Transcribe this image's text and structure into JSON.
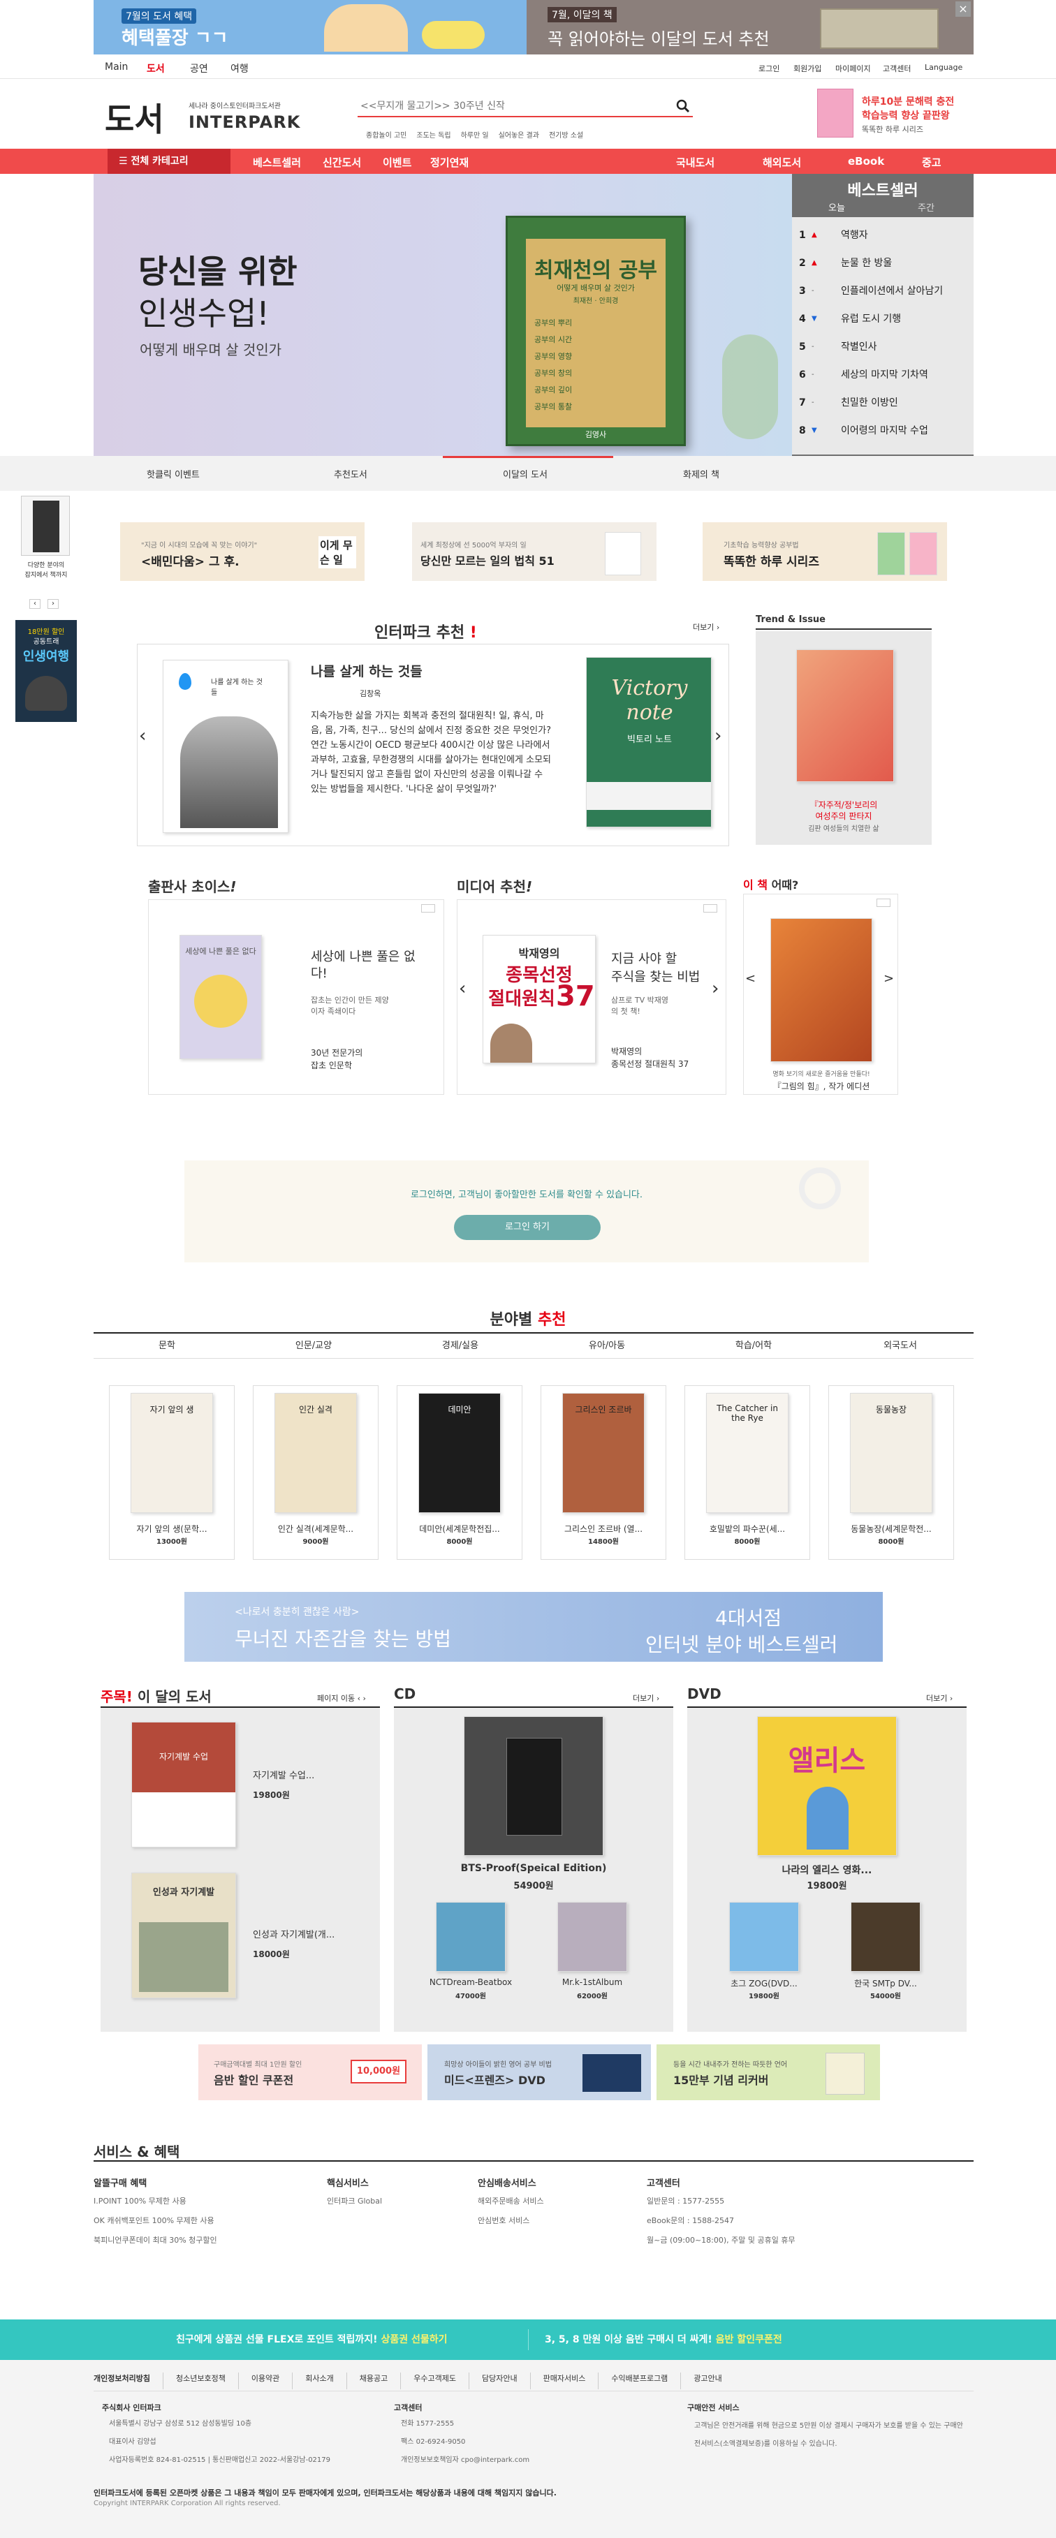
{
  "top_banner": {
    "left_small": "7월의 도서 혜택",
    "left_big": "혜택풀장 ㄱㄱ",
    "right_small": "7월, 이달의 책",
    "right_big": "꼭 읽어야하는 이달의 도서 추천",
    "close": "×"
  },
  "gnb": {
    "items": [
      "Main",
      "도서",
      "공연",
      "여행"
    ],
    "util": [
      "로그인",
      "회원가입",
      "마이페이지",
      "고객센터",
      "Language"
    ]
  },
  "logo": {
    "big": "도서",
    "sub": "세나라 중이스토인터파크도서관",
    "brand": "INTERPARK"
  },
  "search": {
    "placeholder": "<<무지개 물고기>> 30주년 신작",
    "tags": [
      "종합놀이 고민",
      "조도는 독립",
      "하루만 일",
      "실어놓은 결과",
      "전기방 소설"
    ]
  },
  "side_promo": {
    "line1": "하루10분 문해력 충전",
    "line2": "학습능력 향상 끝판왕",
    "line3": "똑똑한 하루 시리즈"
  },
  "nav": {
    "category": "전체 카테고리",
    "left": [
      "베스트셀러",
      "신간도서",
      "이벤트",
      "정기연재"
    ],
    "right": [
      "국내도서",
      "해외도서",
      "eBook",
      "중고"
    ]
  },
  "hero": {
    "line1": "당신을 위한",
    "line2": "인생수업!",
    "sub": "어떻게 배우며 살 것인가",
    "book_title": "최재천의 공부",
    "book_sub": "어떻게 배우며 살 것인가",
    "book_author": "최재천 · 안희경",
    "book_lines": [
      "공부의 뿌리",
      "공부의 시간",
      "공부의 영향",
      "공부의 창의",
      "공부의 깊이",
      "공부의 통찰"
    ],
    "book_publisher": "김영사"
  },
  "bestseller": {
    "title": "베스트셀러",
    "tabs": [
      "오늘",
      "주간"
    ],
    "items": [
      {
        "rank": "1",
        "trend": "up",
        "title": "역행자"
      },
      {
        "rank": "2",
        "trend": "up",
        "title": "눈물 한 방울"
      },
      {
        "rank": "3",
        "trend": "same",
        "title": "인플레이션에서 살아남기"
      },
      {
        "rank": "4",
        "trend": "down",
        "title": "유럽 도시 기행"
      },
      {
        "rank": "5",
        "trend": "same",
        "title": "작별인사"
      },
      {
        "rank": "6",
        "trend": "same",
        "title": "세상의 마지막 기차역"
      },
      {
        "rank": "7",
        "trend": "same",
        "title": "친밀한 이방인"
      },
      {
        "rank": "8",
        "trend": "down",
        "title": "이어령의 마지막 수업"
      }
    ]
  },
  "hero_tabs": [
    "핫클릭 이벤트",
    "추천도서",
    "이달의 도서",
    "화제의 책"
  ],
  "left_float": {
    "text1": "다양한 분야의",
    "text2": "잡지에서 책까지",
    "text3": "18만원 할인",
    "text4": "공동트래",
    "text5": "인생여행",
    "prev": "‹",
    "next": "›"
  },
  "ad_banners": [
    {
      "small": "\"지금 이 시대의 모습에 꼭 맞는 이야기\"",
      "big": "<배민다움> 그 후.",
      "side": "이게 무슨 일"
    },
    {
      "small": "세계 최정상에 선 5000억 부자의 일",
      "big": "당신만 모르는 일의 법칙 51",
      "side": ""
    },
    {
      "small": "기초학습 능력향상 공부법",
      "big": "똑똑한 하루 시리즈",
      "side": ""
    }
  ],
  "recommend": {
    "title": "인터파크 추천",
    "mark": "!",
    "more": "더보기 ›",
    "book_title": "나를 살게 하는 것들",
    "author": "김창옥",
    "desc": "지속가능한 삶을 가지는 회복과 충전의 절대원칙! 일, 휴식, 마음, 몸, 가족, 친구... 당신의 삶에서 진정 중요한 것은 무엇인가? 연간 노동시간이 OECD 평균보다 400시간 이상 많은 나라에서 과부하, 고효율, 무한경쟁의 시대를 살아가는 현대인에게 소모되거나 탈진되지 않고 흔들림 없이 자신만의 성공을 이뤄나갈 수 있는 방법들을 제시한다. '나다운 삶이 무엇일까?'",
    "cover_small": "나를 살게 하는 것들",
    "right_cover_title": "Victory note",
    "right_cover_sub": "빅토리 노트",
    "prev": "‹",
    "next": "›"
  },
  "trend": {
    "title": "Trend & Issue",
    "caption1": "『자주적/정'보리의",
    "caption2": "여성주의 판타지",
    "caption3": "김판 여성들의 치열한 삶"
  },
  "publisher_choice": {
    "title": "출판사 초이스",
    "mark": "!",
    "cover": "세상에 나쁜 풀은 없다",
    "book_title": "세상에 나쁜 풀은 없다!",
    "desc": "잡초는 인간이 만든 제양이자 족쇄이다",
    "author_line1": "30년 전문가의",
    "author_line2": "잡초 인문학"
  },
  "media": {
    "title": "미디어 추천",
    "mark": "!",
    "cover_top": "박재영의",
    "cover_big": "종목선정",
    "cover_big2": "절대원칙",
    "cover_num": "37",
    "book_title1": "지금 사야 할",
    "book_title2": "주식을 찾는 비법",
    "desc": "삼프로 TV 박재영의 첫 책!",
    "author1": "박재영의",
    "author2": "종목선정 절대원칙 37",
    "prev": "‹",
    "next": "›"
  },
  "this_book": {
    "title_red": "이 책",
    "title_rest": " 어때?",
    "caption1": "명화 보기의 새로운 즐거움을 만들다!",
    "caption2": "『그림의 힘』, 작가 에디션",
    "prev": "<",
    "next": ">"
  },
  "login_box": {
    "text": "로그인하면, 고객님이 좋아할만한 도서를 확인할 수 있습니다.",
    "button": "로그인 하기"
  },
  "field": {
    "title_a": "분야별",
    "title_b": "추천",
    "tabs": [
      "문학",
      "인문/교양",
      "경제/실용",
      "유아/아동",
      "학습/어학",
      "외국도서"
    ],
    "books": [
      {
        "title": "자기 앞의 생(문학...",
        "price": "13000원",
        "cover": "자기 앞의 생"
      },
      {
        "title": "인간 실격(세계문학...",
        "price": "9000원",
        "cover": "인간 실격"
      },
      {
        "title": "데미안(세계문학전집...",
        "price": "8000원",
        "cover": "데미안"
      },
      {
        "title": "그리스인 조르바 (열...",
        "price": "14800원",
        "cover": "그리스인 조르바"
      },
      {
        "title": "호밀밭의 파수꾼(세...",
        "price": "8000원",
        "cover": "The Catcher in the Rye"
      },
      {
        "title": "동물농장(세계문학전...",
        "price": "8000원",
        "cover": "동물농장"
      }
    ]
  },
  "wide_banner": {
    "small": "<나로서 충분히 괜찮은 사람>",
    "big": "무너진 자존감을 찾는 방법",
    "right1": "4대서점",
    "right2": "인터넷 분야 베스트셀러"
  },
  "monthly": {
    "title_red": "주목!",
    "title_rest": " 이 달의 도서",
    "pager": "페이지 이동 ‹ ›",
    "items": [
      {
        "title": "자기계발 수업...",
        "price": "19800원",
        "cover": "자기계발 수업"
      },
      {
        "title": "인성과 자기계발(개...",
        "price": "18000원",
        "cover": "인성과 자기계발"
      }
    ]
  },
  "cd": {
    "title": "CD",
    "more": "더보기 ›",
    "main_title": "BTS-Proof(Speical Edition)",
    "main_price": "54900원",
    "items": [
      {
        "title": "NCTDream-Beatbox",
        "price": "47000원"
      },
      {
        "title": "Mr.k-1stAlbum",
        "price": "62000원"
      }
    ]
  },
  "dvd": {
    "title": "DVD",
    "more": "더보기 ›",
    "main_title": "나라의 엘리스 영화...",
    "main_price": "19800원",
    "cover": "앨리스",
    "items": [
      {
        "title": "초그 ZOG(DVD...",
        "price": "19800원"
      },
      {
        "title": "한국 SMTp DV...",
        "price": "54000원"
      }
    ]
  },
  "coupons": [
    {
      "small": "구매금액대별 최대 1만원 할인",
      "big": "음반 할인 쿠폰전",
      "tag": "10,000원"
    },
    {
      "small": "희망상 아이들이 밝힌 영어 공부 비법",
      "big": "미드<프렌즈> DVD",
      "tag": ""
    },
    {
      "small": "등을 시간 내내주가 전하는 따듯한 언어",
      "big": "15만부 기념 리커버",
      "tag": ""
    }
  ],
  "services": {
    "title": "서비스 & 혜택",
    "cols": [
      {
        "head": "알뜰구매 혜택",
        "items": [
          "I.POINT 100% 무제한 사용",
          "OK 캐쉬백포인트 100% 무제한 사용",
          "북피니언쿠폰데이 최대 30% 청구할인"
        ]
      },
      {
        "head": "핵심서비스",
        "items": [
          "인터파크 Global"
        ]
      },
      {
        "head": "안심배송서비스",
        "items": [
          "해외주문배송 서비스",
          "안심번호 서비스"
        ]
      },
      {
        "head": "고객센터",
        "items": [
          "일반문의 : 1577-2555",
          "eBook문의 : 1588-2547",
          "월~금 (09:00~18:00), 주말 및 공휴일 휴무"
        ]
      }
    ]
  },
  "teal_bar": {
    "a1": "친구에게 상품권 선물 FLEX로 포인트 적립까지!",
    "a2": "상품권 선물하기",
    "b1": "3, 5, 8 만원 이상 음반 구매시 더 싸게!",
    "b2": "음반 할인쿠폰전"
  },
  "footer": {
    "links": [
      "개인정보처리방침",
      "청소년보호정책",
      "이용약관",
      "회사소개",
      "채용공고",
      "우수고객제도",
      "담당자안내",
      "판매자서비스",
      "수익배분프로그램",
      "광고안내"
    ],
    "company_head": "주식회사 인터파크",
    "company": [
      "서울특별시 강남구 삼성로 512 삼성동빌딩 10층",
      "대표이사 김양섭",
      "사업자등록번호 824-81-02515 | 통신판매업신고 2022-서울강남-02179"
    ],
    "center_head": "고객센터",
    "center": [
      "전화 1577-2555",
      "팩스 02-6924-9050",
      "개인정보보호책임자 cpo@interpark.com"
    ],
    "escrow_head": "구매안전 서비스",
    "escrow": [
      "고객님은 안전거래를 위해 현금으로 5만원 이상 결제시 구매자가 보호를 받을 수 있는 구매안전서비스(소액결제보증)를 이용하실 수 있습니다."
    ],
    "notice": "인터파크도서에 등록된 오픈마켓 상품은 그 내용과 책임이 모두 판매자에게 있으며, 인터파크도서는 해당상품과 내용에 대해 책임지지 않습니다.",
    "copyright": "Copyright INTERPARK Corporation All rights reserved."
  },
  "colors": {
    "accent": "#e83c3c",
    "nav_red": "#f04b4b",
    "teal": "#34c6c0",
    "bestseller_bg": "#6e6e6e"
  }
}
